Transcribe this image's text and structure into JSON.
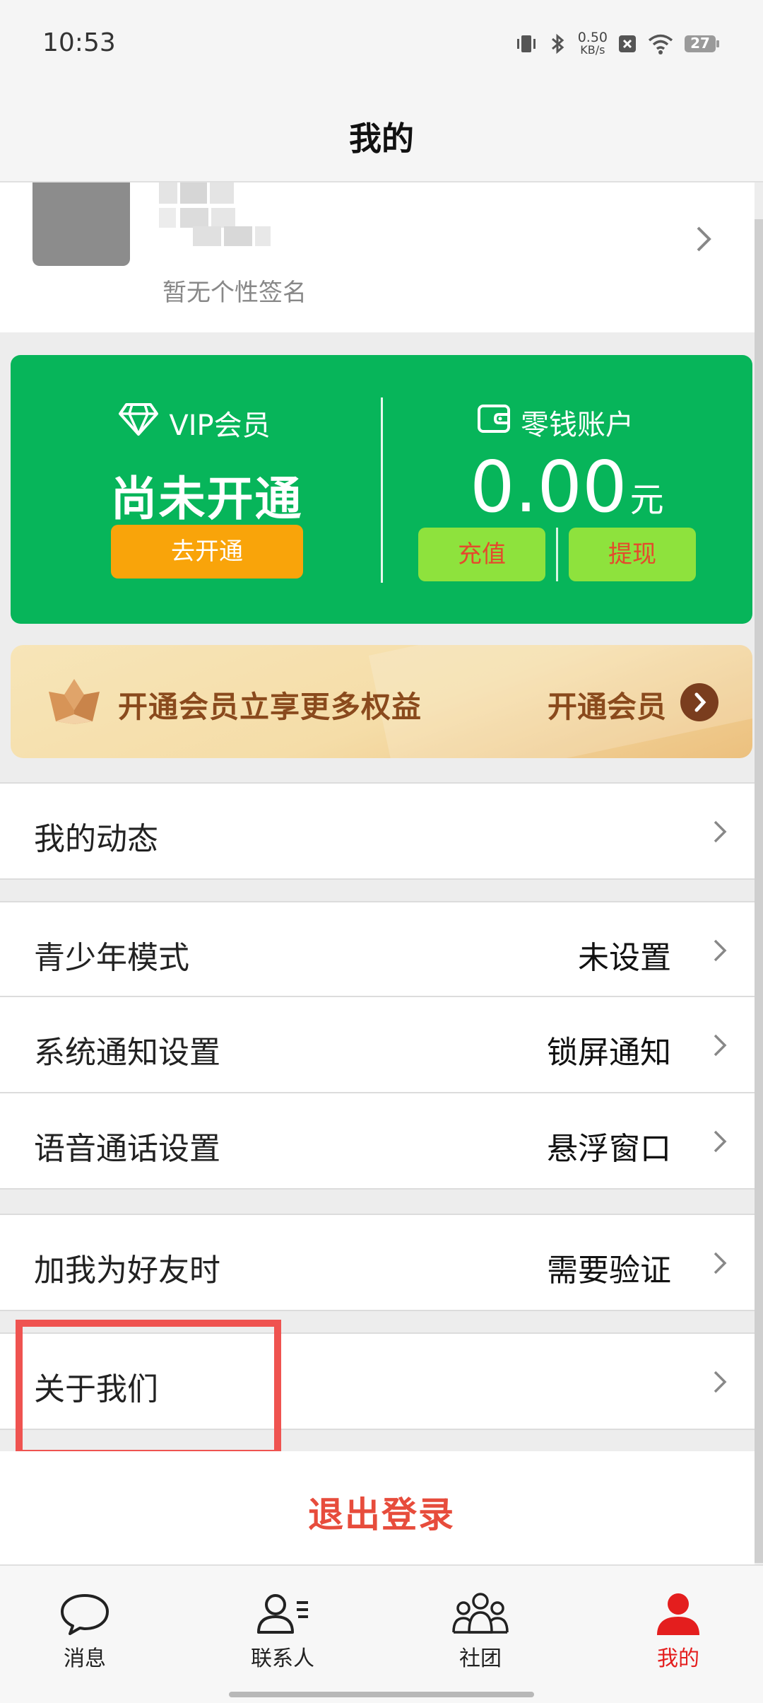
{
  "status_bar": {
    "time": "10:53",
    "net_speed_value": "0.50",
    "net_speed_unit": "KB/s",
    "battery": "27"
  },
  "header": {
    "title": "我的"
  },
  "profile": {
    "signature": "暂无个性签名"
  },
  "vip": {
    "label": "VIP会员",
    "status": "尚未开通",
    "button": "去开通"
  },
  "wallet": {
    "label": "零钱账户",
    "amount": "0.00",
    "unit": "元",
    "recharge": "充值",
    "withdraw": "提现"
  },
  "member_banner": {
    "text": "开通会员立享更多权益",
    "action": "开通会员"
  },
  "menu": {
    "my_posts": {
      "label": "我的动态"
    },
    "teen_mode": {
      "label": "青少年模式",
      "value": "未设置"
    },
    "notification": {
      "label": "系统通知设置",
      "value": "锁屏通知"
    },
    "voice_call": {
      "label": "语音通话设置",
      "value": "悬浮窗口"
    },
    "add_friend": {
      "label": "加我为好友时",
      "value": "需要验证"
    },
    "about_us": {
      "label": "关于我们"
    }
  },
  "logout": {
    "label": "退出登录"
  },
  "tabbar": {
    "tabs": [
      {
        "label": "消息",
        "icon": "chat-bubble-icon"
      },
      {
        "label": "联系人",
        "icon": "contacts-icon"
      },
      {
        "label": "社团",
        "icon": "group-icon"
      },
      {
        "label": "我的",
        "icon": "person-icon",
        "active": true
      }
    ]
  },
  "colors": {
    "green_card": "#07b55a",
    "open_button": "#f9a40a",
    "small_button": "#8ee23d",
    "logout": "#e74c3c",
    "active_tab": "#e41e1e",
    "highlight": "#ef5350"
  }
}
